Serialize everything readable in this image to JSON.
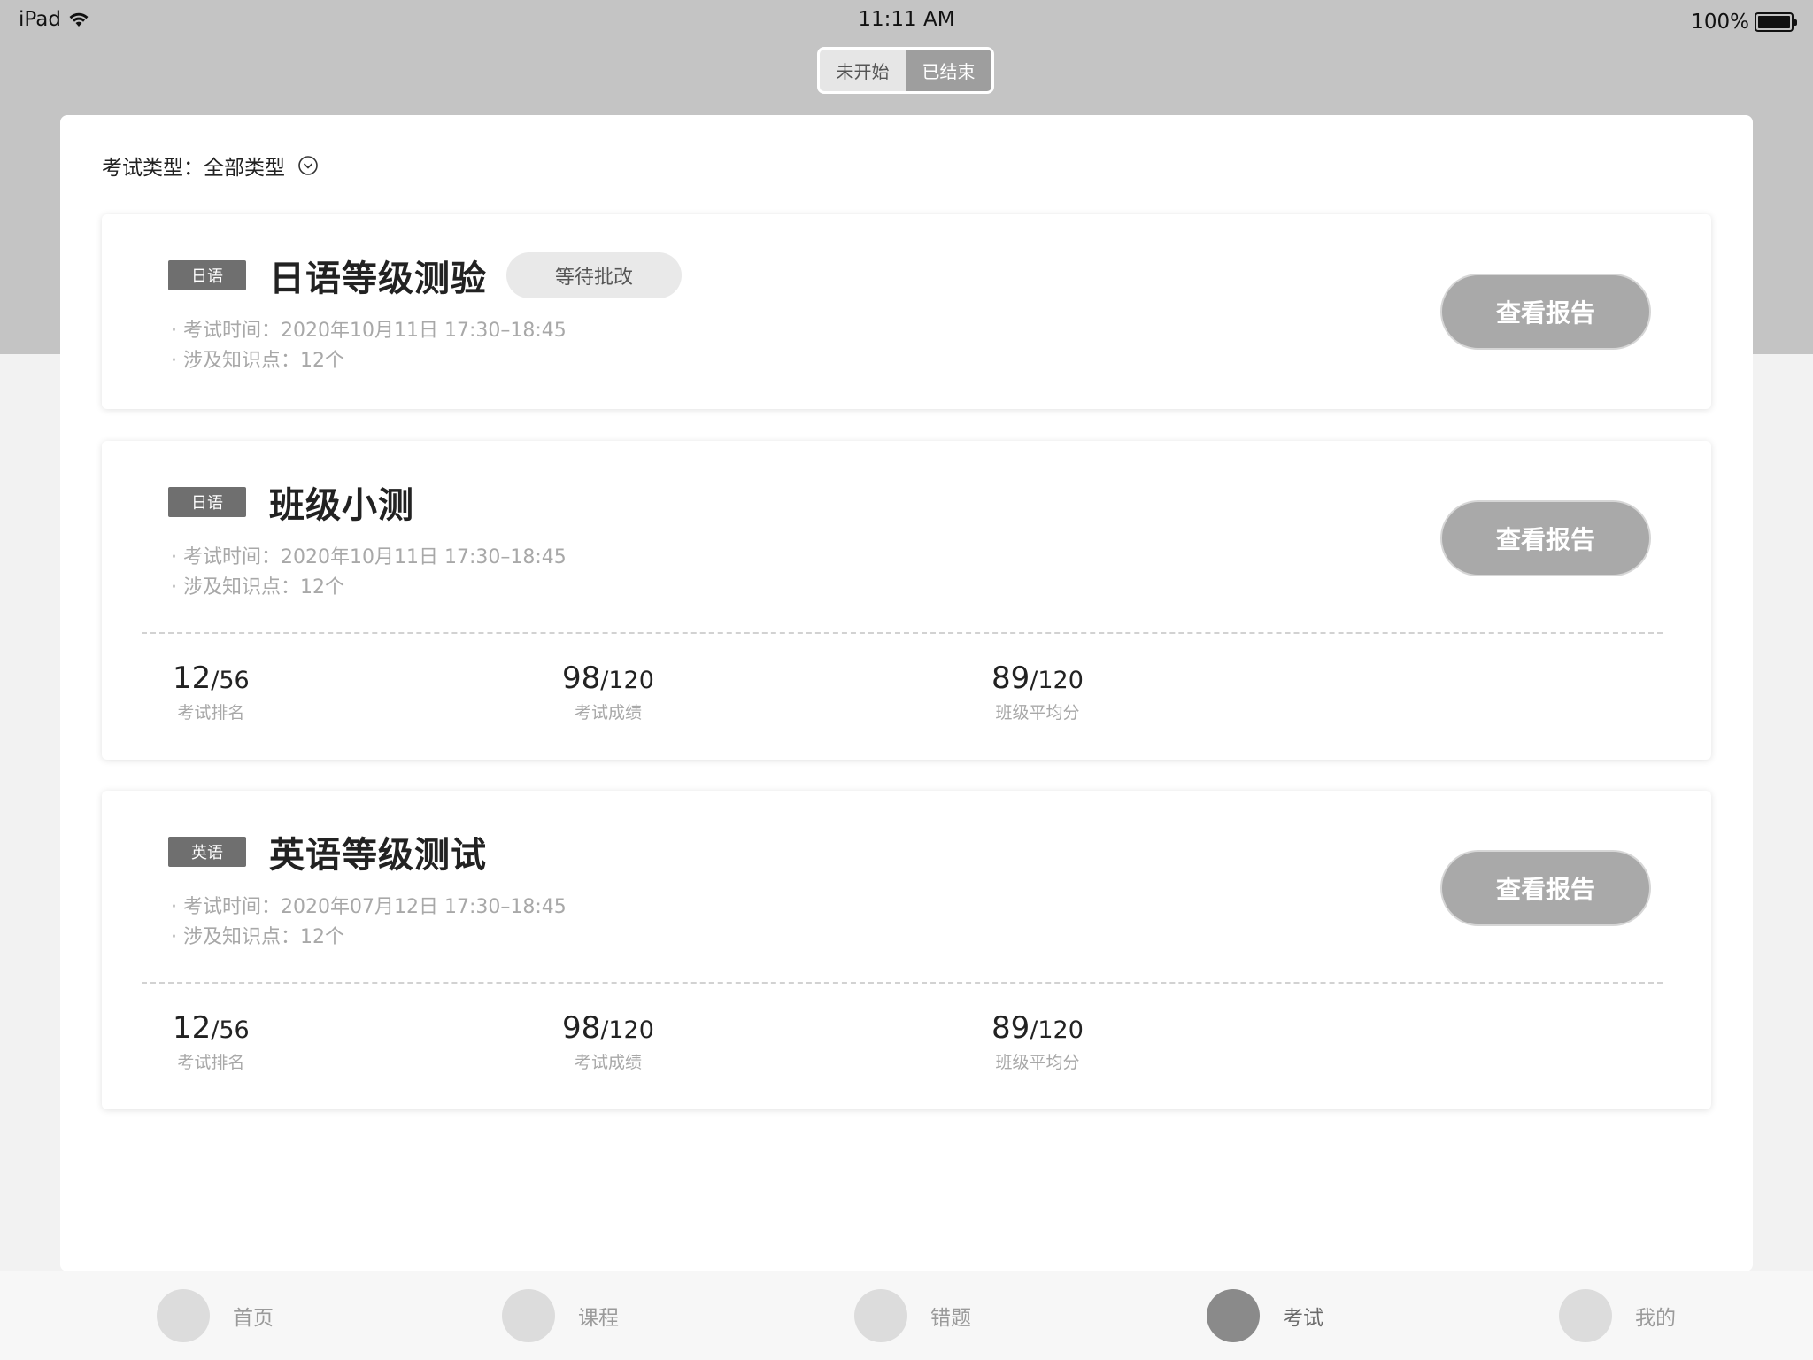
{
  "status_bar": {
    "device": "iPad",
    "time": "11:11 AM",
    "battery": "100%"
  },
  "segmented": {
    "items": [
      "未开始",
      "已结束"
    ],
    "selected": "已结束"
  },
  "filter": {
    "label": "考试类型：",
    "value": "全部类型",
    "icon": "chevron-down-circle-icon"
  },
  "exams": [
    {
      "tag": "日语",
      "title": "日语等级测验",
      "badge": "等待批改",
      "time": "考试时间：2020年10月11日 17:30–18:45",
      "knowledge": "涉及知识点：12个",
      "button": "查看报告"
    },
    {
      "tag": "日语",
      "title": "班级小测",
      "time": "考试时间：2020年10月11日 17:30–18:45",
      "knowledge": "涉及知识点：12个",
      "button": "查看报告",
      "stats": [
        {
          "value": "12",
          "total": "/56",
          "label": "考试排名"
        },
        {
          "value": "98",
          "total": "/120",
          "label": "考试成绩"
        },
        {
          "value": "89",
          "total": "/120",
          "label": "班级平均分"
        }
      ]
    },
    {
      "tag": "英语",
      "title": "英语等级测试",
      "time": "考试时间：2020年07月12日 17:30–18:45",
      "knowledge": "涉及知识点：12个",
      "button": "查看报告",
      "stats": [
        {
          "value": "12",
          "total": "/56",
          "label": "考试排名"
        },
        {
          "value": "98",
          "total": "/120",
          "label": "考试成绩"
        },
        {
          "value": "89",
          "total": "/120",
          "label": "班级平均分"
        }
      ]
    }
  ],
  "tabbar": {
    "items": [
      "首页",
      "课程",
      "错题",
      "考试",
      "我的"
    ],
    "active": "考试"
  }
}
